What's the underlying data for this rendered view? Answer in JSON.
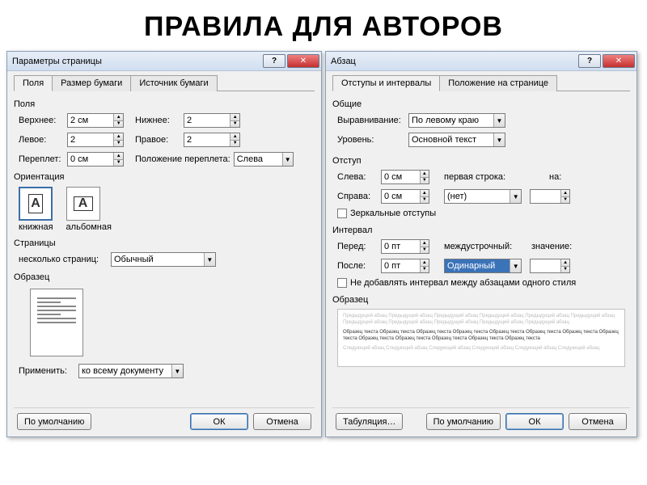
{
  "page_title": "ПРАВИЛА ДЛЯ АВТОРОВ",
  "d1": {
    "title": "Параметры страницы",
    "tabs": [
      "Поля",
      "Размер бумаги",
      "Источник бумаги"
    ],
    "fields_label": "Поля",
    "top_label": "Верхнее:",
    "top_value": "2 см",
    "bottom_label": "Нижнее:",
    "bottom_value": "2",
    "left_label": "Левое:",
    "left_value": "2",
    "right_label": "Правое:",
    "right_value": "2",
    "gutter_label": "Переплет:",
    "gutter_value": "0 см",
    "gutter_pos_label": "Положение переплета:",
    "gutter_pos_value": "Слева",
    "orientation_label": "Ориентация",
    "portrait": "книжная",
    "landscape": "альбомная",
    "pages_label": "Страницы",
    "multi_pages_label": "несколько страниц:",
    "multi_pages_value": "Обычный",
    "sample_label": "Образец",
    "apply_label": "Применить:",
    "apply_value": "ко всему документу",
    "default_btn": "По умолчанию",
    "ok_btn": "ОК",
    "cancel_btn": "Отмена"
  },
  "d2": {
    "title": "Абзац",
    "tabs": [
      "Отступы и интервалы",
      "Положение на странице"
    ],
    "general_label": "Общие",
    "align_label": "Выравнивание:",
    "align_value": "По левому краю",
    "level_label": "Уровень:",
    "level_value": "Основной текст",
    "indent_label": "Отступ",
    "ileft_label": "Слева:",
    "ileft_value": "0 см",
    "iright_label": "Справа:",
    "iright_value": "0 см",
    "firstline_label": "первая строка:",
    "firstline_value": "(нет)",
    "on_label": "на:",
    "on_value": "",
    "mirror_label": "Зеркальные отступы",
    "spacing_label": "Интервал",
    "before_label": "Перед:",
    "before_value": "0 пт",
    "after_label": "После:",
    "after_value": "0 пт",
    "linespacing_label": "междустрочный:",
    "linespacing_value": "Одинарный",
    "value_label": "значение:",
    "value_value": "",
    "noadd_label": "Не добавлять интервал между абзацами одного стиля",
    "sample_label": "Образец",
    "sample_ghost": "Предыдущий абзац Предыдущий абзац Предыдущий абзац Предыдущий абзац Предыдущий абзац Предыдущий абзац Предыдущий абзац Предыдущий абзац Предыдущий абзац Предыдущий абзац Предыдущий абзац",
    "sample_real": "Образец текста Образец текста Образец текста Образец текста Образец текста Образец текста Образец текста Образец текста Образец текста Образец текста Образец текста Образец текста Образец текста",
    "sample_ghost2": "Следующий абзац Следующий абзац Следующий абзац Следующий абзац Следующий абзац Следующий абзац",
    "tabs_btn": "Табуляция…",
    "default_btn": "По умолчанию",
    "ok_btn": "ОК",
    "cancel_btn": "Отмена"
  }
}
